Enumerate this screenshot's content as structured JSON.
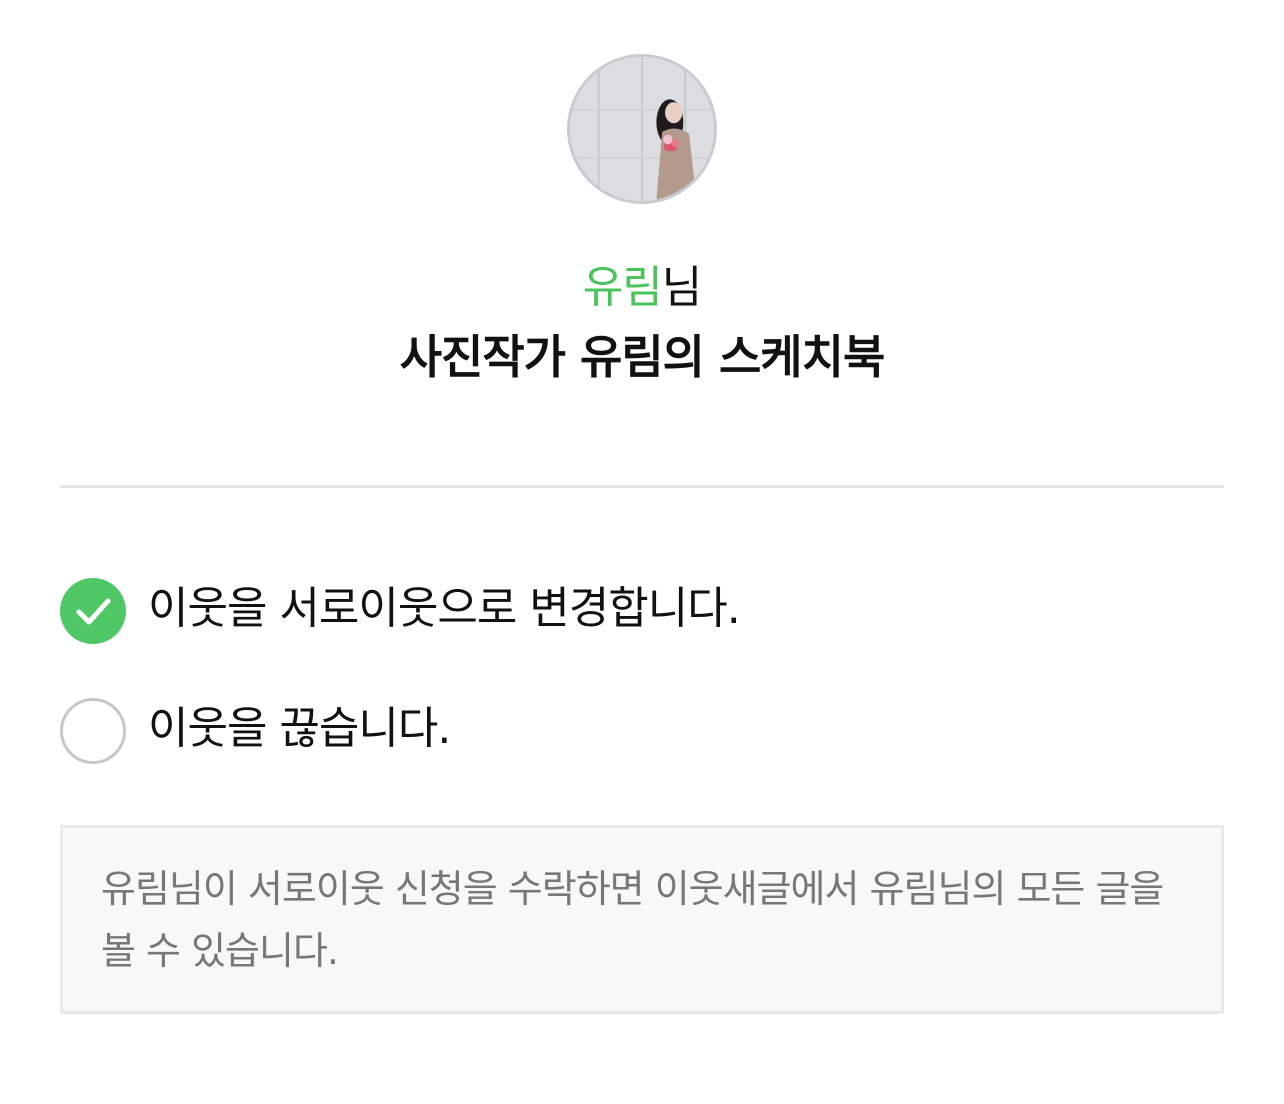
{
  "profile": {
    "avatar_alt": "profile-photo",
    "nickname": "유림",
    "honorific": "님",
    "blog_title": "사진작가 유림의 스케치북"
  },
  "options": [
    {
      "label": "이웃을 서로이웃으로 변경합니다.",
      "selected": true
    },
    {
      "label": "이웃을 끊습니다.",
      "selected": false
    }
  ],
  "notice": {
    "text": "유림님이 서로이웃 신청을 수락하면 이웃새글에서 유림님의 모든 글을 볼 수 있습니다."
  },
  "colors": {
    "accent": "#4fc764",
    "nickname": "#48c45a",
    "muted_text": "#777777",
    "notice_bg": "#f8f8f8"
  },
  "icons": {
    "selected": "check-circle-icon",
    "unselected": "empty-circle-icon"
  }
}
